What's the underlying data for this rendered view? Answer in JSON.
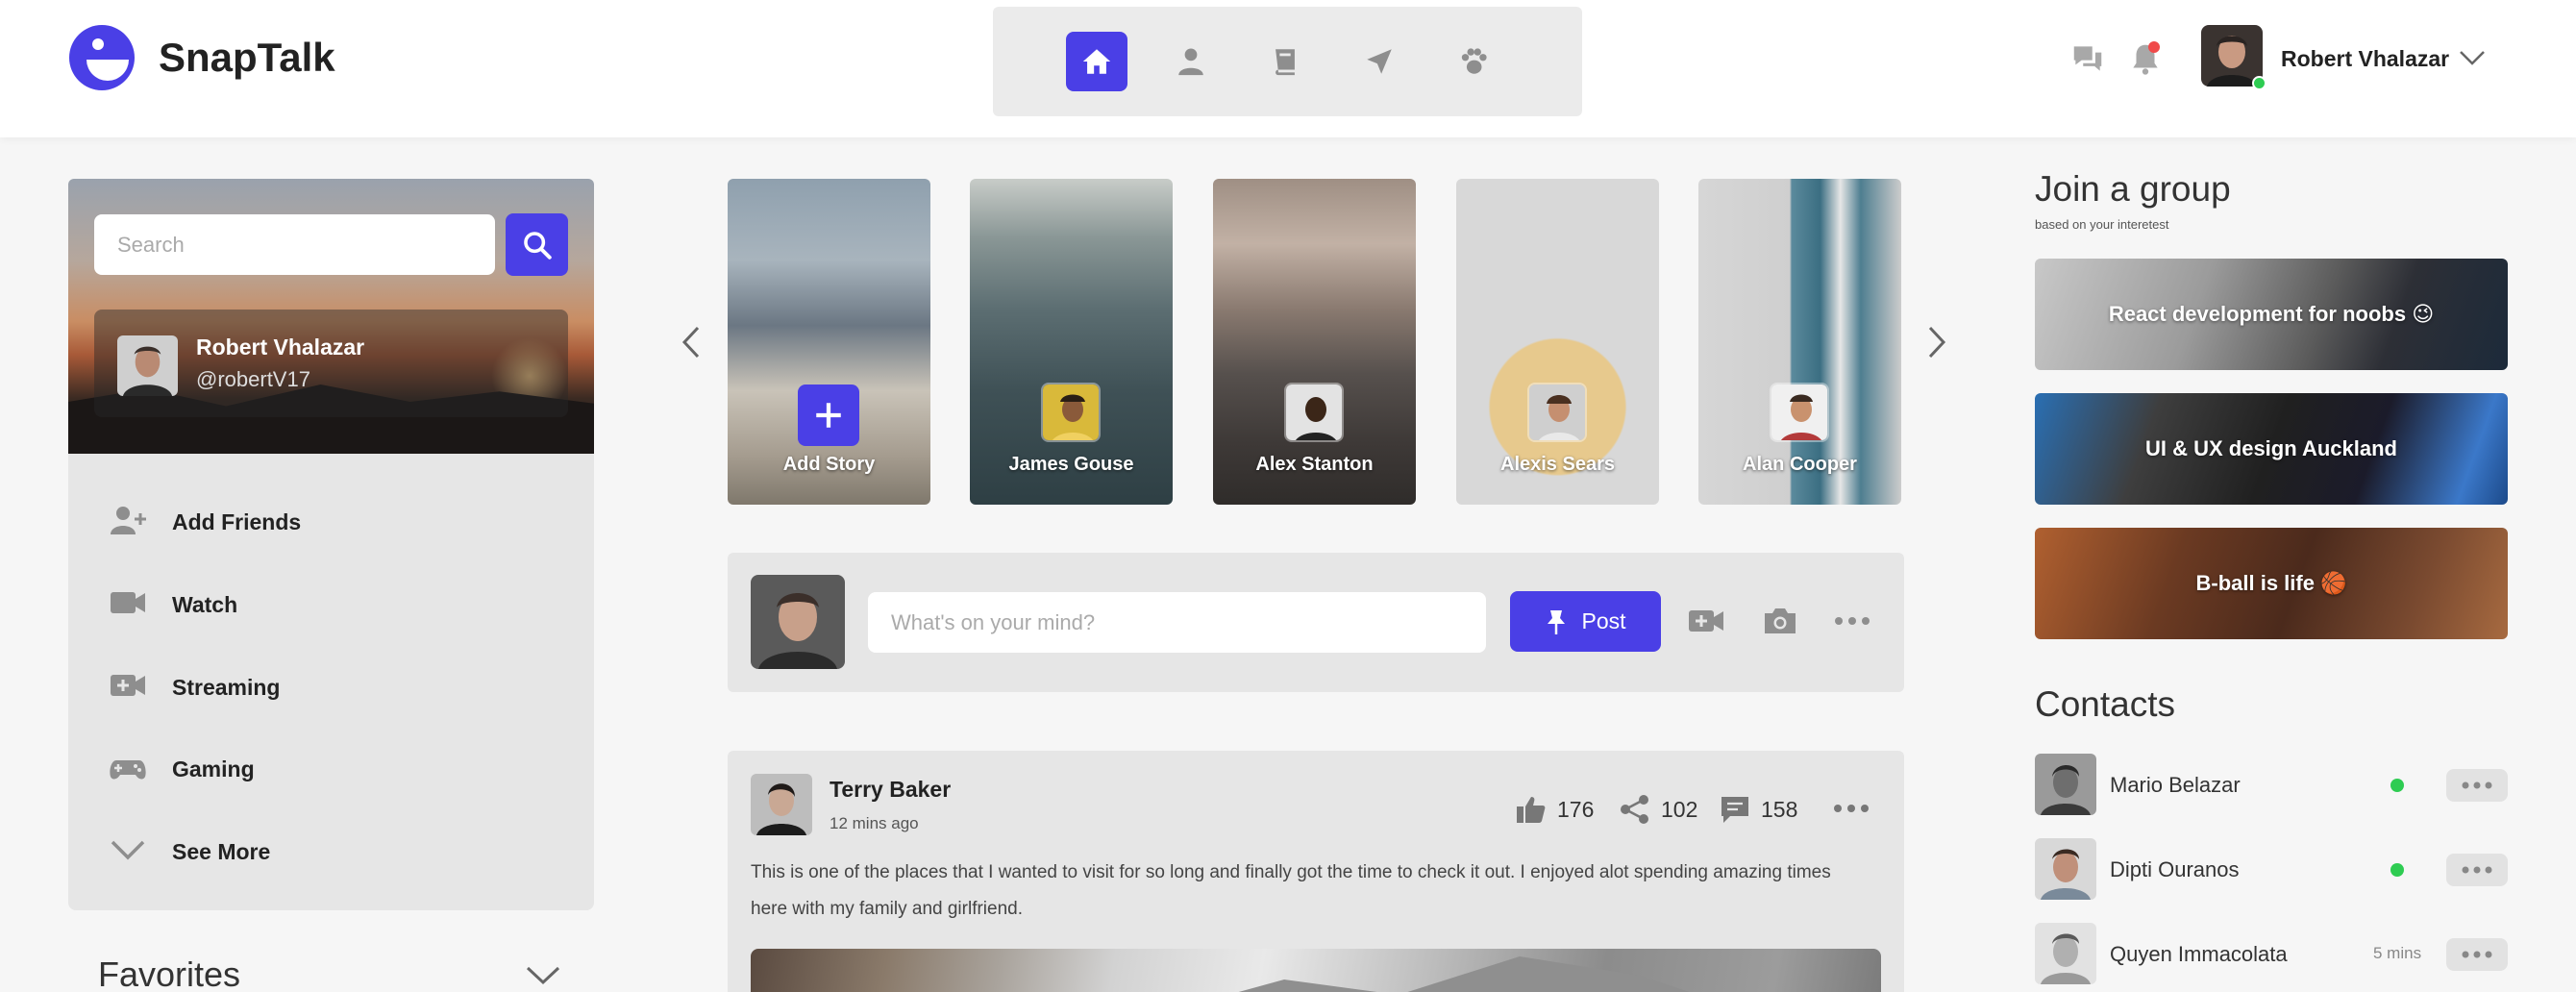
{
  "app": {
    "name": "SnapTalk"
  },
  "nav": {
    "tabs": [
      {
        "icon": "home-icon",
        "active": true
      },
      {
        "icon": "profile-icon",
        "active": false
      },
      {
        "icon": "book-icon",
        "active": false
      },
      {
        "icon": "send-icon",
        "active": false
      },
      {
        "icon": "paw-icon",
        "active": false
      }
    ]
  },
  "header": {
    "user_name": "Robert Vhalazar",
    "icons": [
      "messages-icon",
      "bell-icon",
      "chevron-down-icon"
    ],
    "notification_color": "#f04a4a",
    "online_color": "#2ecc52"
  },
  "sidebar": {
    "search": {
      "placeholder": "Search"
    },
    "profile": {
      "name": "Robert Vhalazar",
      "handle": "@robertV17"
    },
    "menu": [
      {
        "label": "Add Friends",
        "icon": "add-user-icon"
      },
      {
        "label": "Watch",
        "icon": "video-camera-icon"
      },
      {
        "label": "Streaming",
        "icon": "video-plus-icon"
      },
      {
        "label": "Gaming",
        "icon": "gamepad-icon"
      },
      {
        "label": "See More",
        "icon": "chevron-down-icon"
      }
    ],
    "favorites_title": "Favorites"
  },
  "stories": [
    {
      "label": "Add Story"
    },
    {
      "label": "James Gouse"
    },
    {
      "label": "Alex Stanton"
    },
    {
      "label": "Alexis Sears"
    },
    {
      "label": "Alan Cooper"
    }
  ],
  "composer": {
    "placeholder": "What's on your mind?",
    "post_label": "Post"
  },
  "post": {
    "author": "Terry Baker",
    "time": "12 mins ago",
    "likes": "176",
    "shares": "102",
    "comments": "158",
    "text": "This is one of the places that I wanted to visit for so long and finally got the time to check it out. I enjoyed alot spending amazing times here with my family and girlfriend."
  },
  "groups": {
    "title": "Join a group",
    "subtitle": "based on your interetest",
    "items": [
      {
        "label": "React development for noobs 😉"
      },
      {
        "label": "UI & UX design Auckland"
      },
      {
        "label": "B-ball is life 🏀"
      }
    ]
  },
  "contacts": {
    "title": "Contacts",
    "items": [
      {
        "name": "Mario Belazar",
        "status": "online"
      },
      {
        "name": "Dipti Ouranos",
        "status": "online"
      },
      {
        "name": "Quyen Immacolata",
        "status": "5 mins"
      }
    ]
  },
  "colors": {
    "accent": "#4a3fe6",
    "panel": "#e6e6e6",
    "online": "#2ecc52"
  }
}
